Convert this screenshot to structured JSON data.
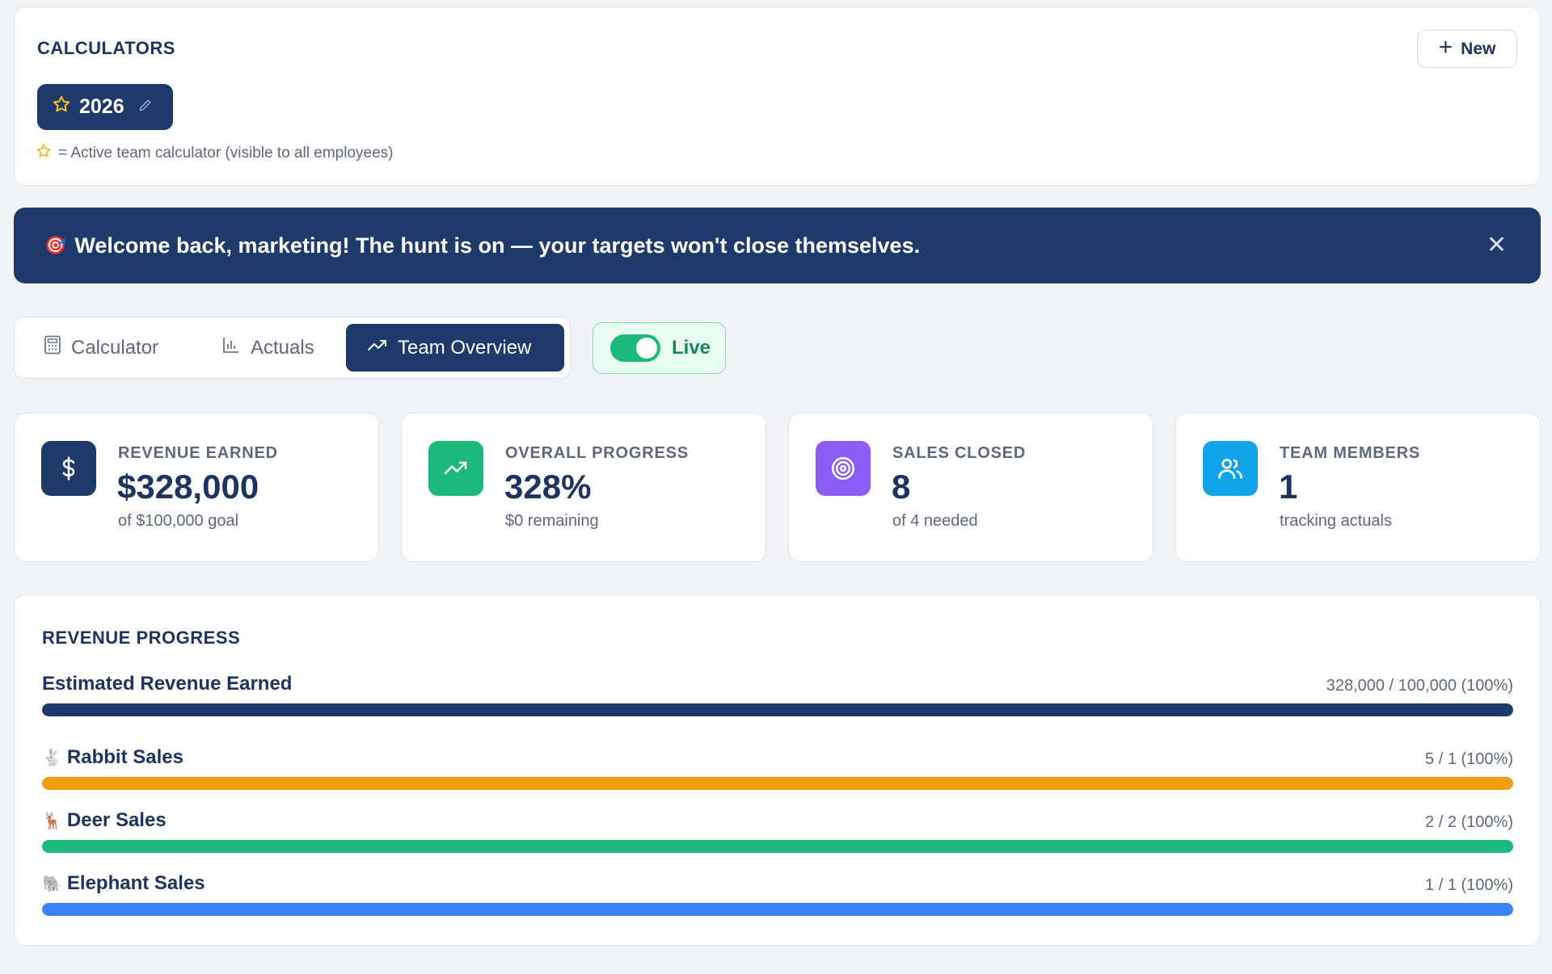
{
  "calculators": {
    "title": "CALCULATORS",
    "new_label": "New",
    "active_year": "2026",
    "legend": "= Active team calculator (visible to all employees)"
  },
  "banner": {
    "icon": "🎯",
    "text": "Welcome back, marketing! The hunt is on — your targets won't close themselves."
  },
  "tabs": [
    {
      "label": "Calculator",
      "icon": "calculator-icon"
    },
    {
      "label": "Actuals",
      "icon": "bar-chart-icon"
    },
    {
      "label": "Team Overview",
      "icon": "trending-up-icon",
      "active": true
    }
  ],
  "live": {
    "label": "Live",
    "on": true
  },
  "stats": [
    {
      "label": "REVENUE EARNED",
      "value": "$328,000",
      "sub": "of $100,000 goal",
      "icon": "dollar-icon",
      "color": "#1d3a6b"
    },
    {
      "label": "OVERALL PROGRESS",
      "value": "328%",
      "sub": "$0 remaining",
      "icon": "trending-up-icon",
      "color": "#1cb97c"
    },
    {
      "label": "SALES CLOSED",
      "value": "8",
      "sub": "of 4 needed",
      "icon": "target-icon",
      "color": "#8b5cf6"
    },
    {
      "label": "TEAM MEMBERS",
      "value": "1",
      "sub": "tracking actuals",
      "icon": "users-icon",
      "color": "#12a4e8"
    }
  ],
  "revenue_progress": {
    "title": "REVENUE PROGRESS",
    "rows": [
      {
        "emoji": "",
        "name": "Estimated Revenue Earned",
        "value": "328,000 / 100,000 (100%)",
        "percent": 100,
        "color": "#1d3a6b"
      },
      {
        "emoji": "🐇",
        "name": "Rabbit Sales",
        "value": "5 / 1 (100%)",
        "percent": 100,
        "color": "#f29e12"
      },
      {
        "emoji": "🦌",
        "name": "Deer Sales",
        "value": "2 / 2 (100%)",
        "percent": 100,
        "color": "#1cb97c"
      },
      {
        "emoji": "🐘",
        "name": "Elephant Sales",
        "value": "1 / 1 (100%)",
        "percent": 100,
        "color": "#3b82f6"
      }
    ]
  }
}
